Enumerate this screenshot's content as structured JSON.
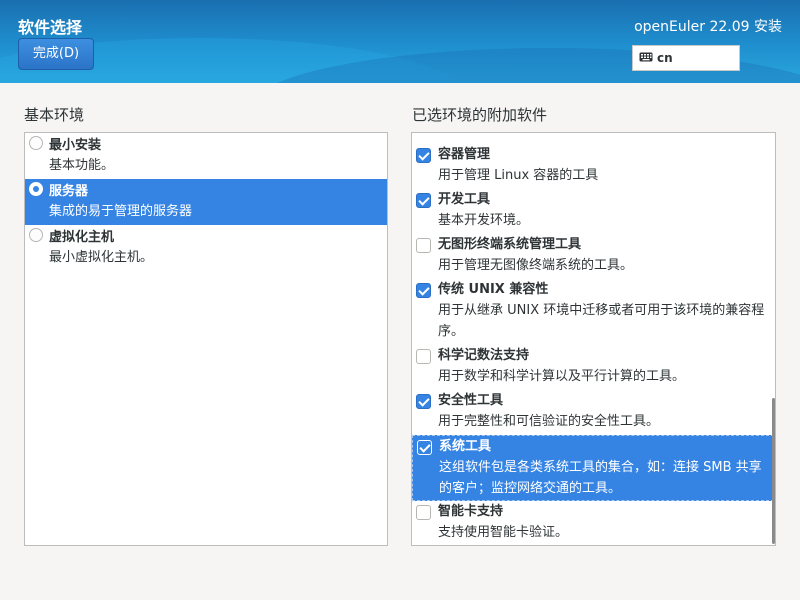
{
  "header": {
    "page_title": "软件选择",
    "done_button": "完成(D)",
    "product_title": "openEuler 22.09 安装",
    "keyboard_layout": "cn"
  },
  "base_environment": {
    "heading": "基本环境",
    "items": [
      {
        "title": "最小安装",
        "description": "基本功能。",
        "selected": false
      },
      {
        "title": "服务器",
        "description": "集成的易于管理的服务器",
        "selected": true
      },
      {
        "title": "虚拟化主机",
        "description": "最小虚拟化主机。",
        "selected": false
      }
    ]
  },
  "addons": {
    "heading": "已选环境的附加软件",
    "items": [
      {
        "title": "容器管理",
        "description": "用于管理 Linux 容器的工具",
        "checked": true
      },
      {
        "title": "开发工具",
        "description": "基本开发环境。",
        "checked": true
      },
      {
        "title": "无图形终端系统管理工具",
        "description": "用于管理无图像终端系统的工具。",
        "checked": false
      },
      {
        "title": "传统 UNIX 兼容性",
        "description": "用于从继承 UNIX 环境中迁移或者可用于该环境的兼容程序。",
        "checked": true
      },
      {
        "title": "科学记数法支持",
        "description": "用于数学和科学计算以及平行计算的工具。",
        "checked": false
      },
      {
        "title": "安全性工具",
        "description": "用于完整性和可信验证的安全性工具。",
        "checked": true
      },
      {
        "title": "系统工具",
        "description": "这组软件包是各类系统工具的集合，如：连接 SMB 共享的客户；监控网络交通的工具。",
        "checked": true
      },
      {
        "title": "智能卡支持",
        "description": "支持使用智能卡验证。",
        "checked": false
      }
    ]
  },
  "colors": {
    "selection": "#3584e4",
    "header_top": "#1a6fb0",
    "header_bottom": "#2aa6dc"
  }
}
